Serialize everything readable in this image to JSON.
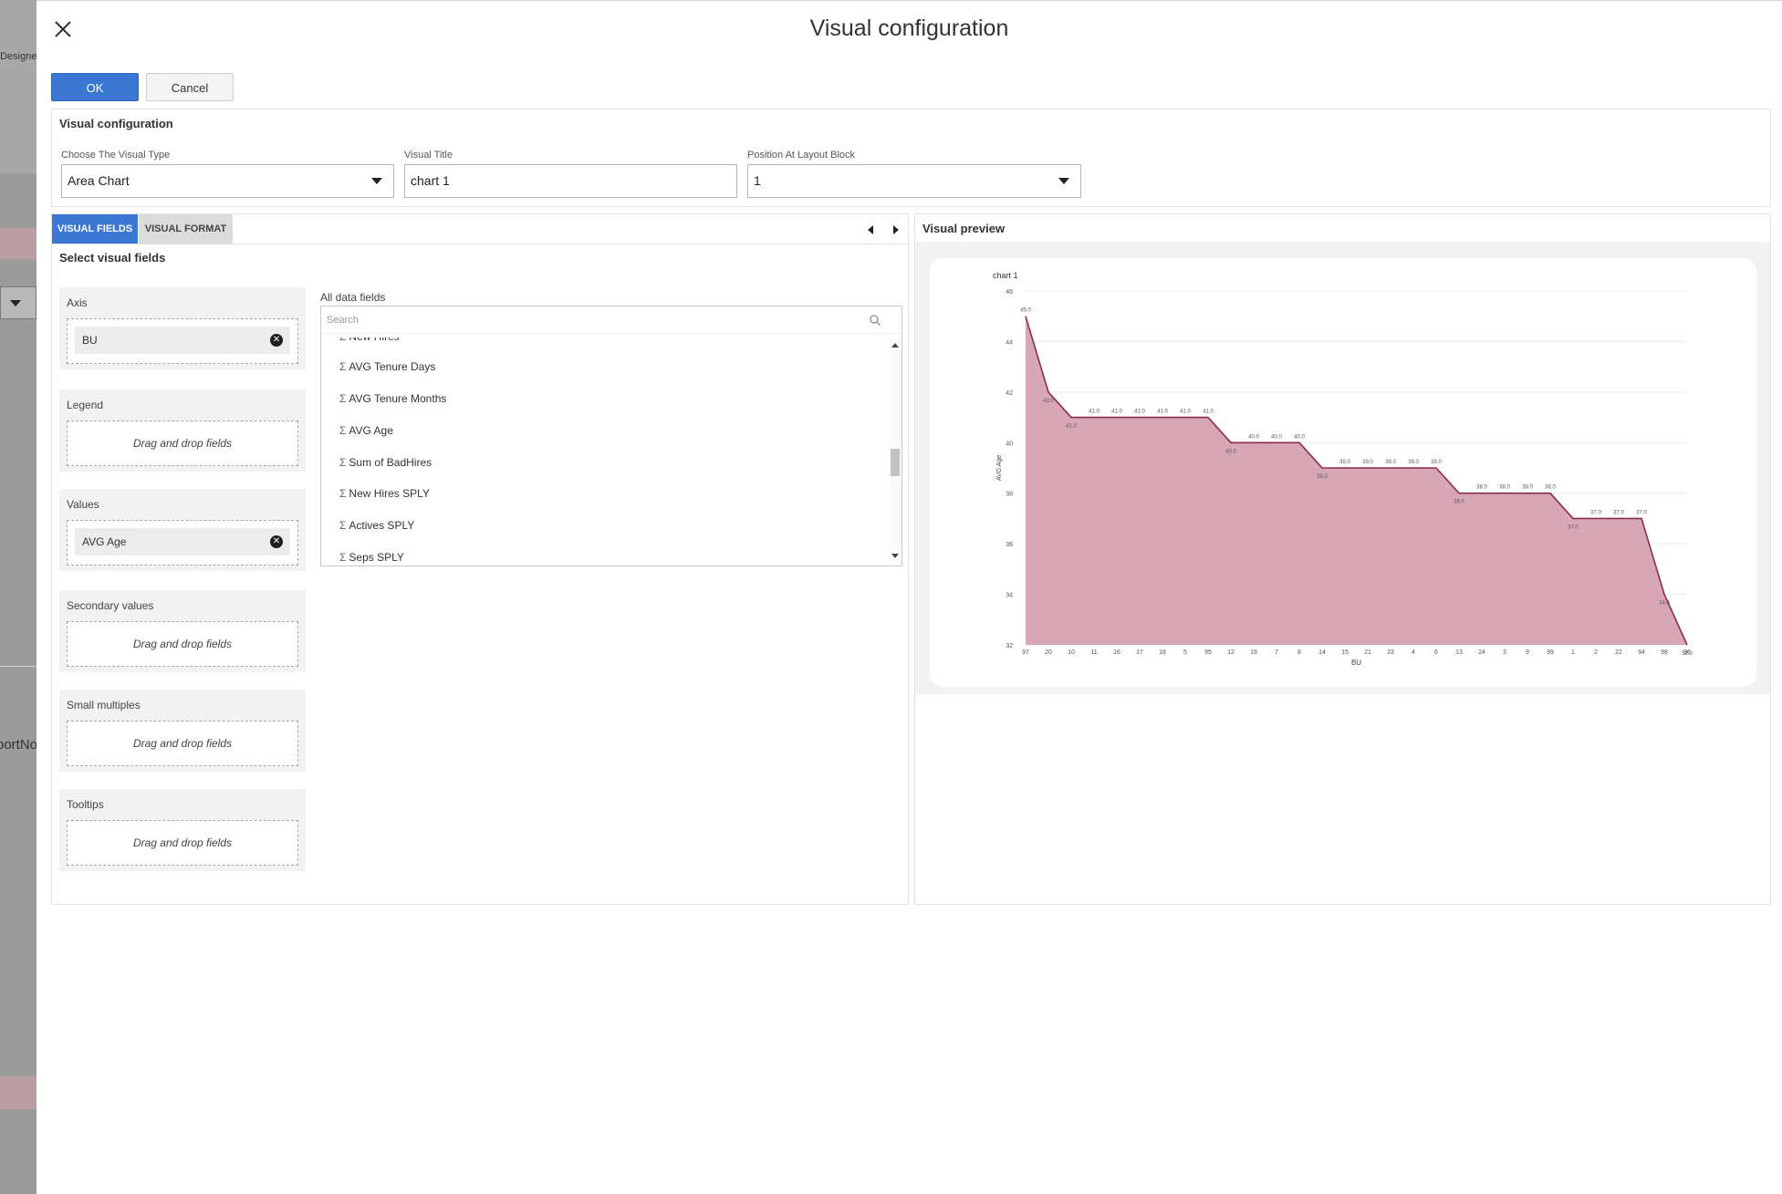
{
  "background": {
    "designer_text": "t Designer",
    "report_text": "portNo"
  },
  "dialog": {
    "title": "Visual configuration",
    "ok_label": "OK",
    "cancel_label": "Cancel"
  },
  "config": {
    "title": "Visual configuration",
    "visual_type": {
      "label": "Choose The Visual Type",
      "value": "Area Chart"
    },
    "visual_title": {
      "label": "Visual Title",
      "value": "chart 1"
    },
    "position": {
      "label": "Position At Layout Block",
      "value": "1"
    }
  },
  "tabs": {
    "fields_label": "VISUAL FIELDS",
    "format_label": "VISUAL FORMAT"
  },
  "fields": {
    "title": "Select visual fields",
    "wells": {
      "axis": {
        "label": "Axis",
        "chip": "BU"
      },
      "legend": {
        "label": "Legend",
        "hint": "Drag and drop fields"
      },
      "values": {
        "label": "Values",
        "chip": "AVG Age"
      },
      "secondary": {
        "label": "Secondary values",
        "hint": "Drag and drop fields"
      },
      "small_multiples": {
        "label": "Small multiples",
        "hint": "Drag and drop fields"
      },
      "tooltips": {
        "label": "Tooltips",
        "hint": "Drag and drop fields"
      }
    },
    "all_fields_label": "All data fields",
    "search_placeholder": "Search",
    "sigma": "Σ",
    "items": [
      "New Hires",
      "AVG Tenure Days",
      "AVG Tenure Months",
      "AVG Age",
      "Sum of BadHires",
      "New Hires SPLY",
      "Actives SPLY",
      "Seps SPLY"
    ]
  },
  "preview": {
    "title": "Visual preview"
  },
  "colors": {
    "accent": "#3a78d4",
    "area_fill": "#d8a7b6",
    "area_line": "#8c2a4e"
  },
  "chart_data": {
    "type": "area",
    "title": "chart 1",
    "xlabel": "BU",
    "ylabel": "AVG Age",
    "ylim": [
      32,
      46
    ],
    "yticks": [
      32,
      34,
      36,
      38,
      40,
      42,
      44,
      46
    ],
    "grid": true,
    "categories": [
      "97",
      "20",
      "10",
      "11",
      "16",
      "17",
      "18",
      "5",
      "95",
      "12",
      "19",
      "7",
      "8",
      "14",
      "15",
      "21",
      "23",
      "4",
      "6",
      "13",
      "24",
      "3",
      "9",
      "99",
      "1",
      "2",
      "22",
      "94",
      "98",
      "96"
    ],
    "values": [
      45.0,
      42.0,
      41.0,
      41.0,
      41.0,
      41.0,
      41.0,
      41.0,
      41.0,
      40.0,
      40.0,
      40.0,
      40.0,
      39.0,
      39.0,
      39.0,
      39.0,
      39.0,
      39.0,
      38.0,
      38.0,
      38.0,
      38.0,
      38.0,
      37.0,
      37.0,
      37.0,
      37.0,
      34.0,
      32.0
    ],
    "data_labels": [
      "45.0",
      "42.0",
      "41.0",
      "41.0",
      "41.0",
      "41.0",
      "41.0",
      "41.0",
      "41.0",
      "40.0",
      "40.0",
      "40.0",
      "40.0",
      "39.0",
      "39.0",
      "39.0",
      "39.0",
      "39.0",
      "39.0",
      "38.0",
      "38.0",
      "38.0",
      "38.0",
      "38.0",
      "37.0",
      "37.0",
      "37.0",
      "37.0",
      "34.0",
      "32.0"
    ]
  }
}
